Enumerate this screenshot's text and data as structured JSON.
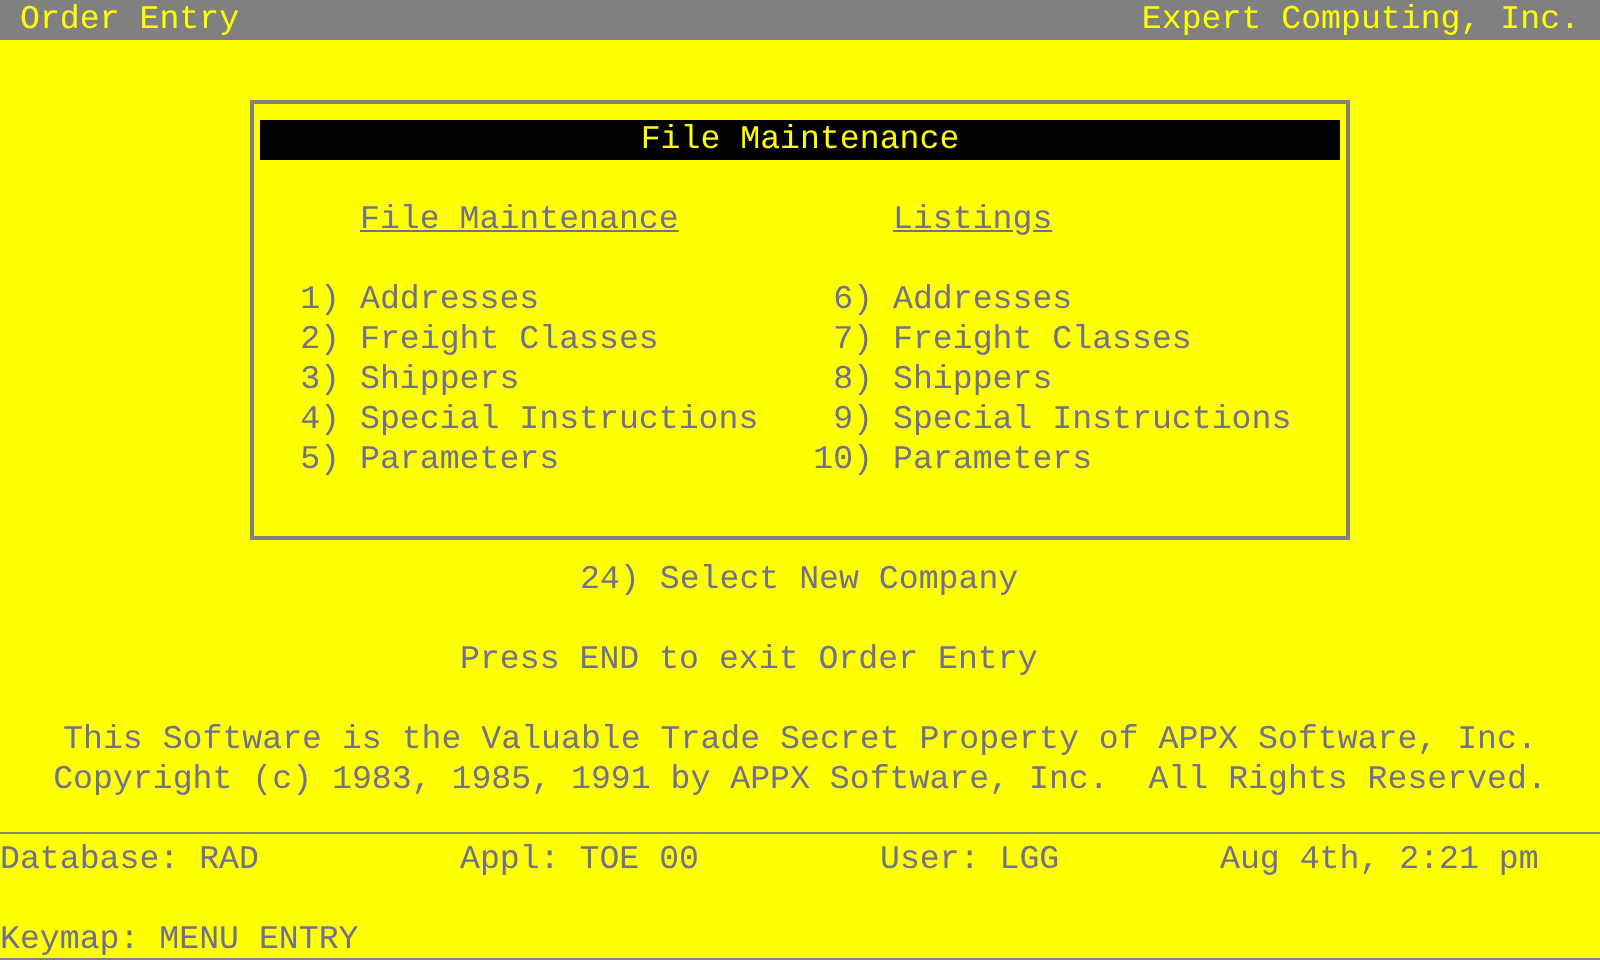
{
  "title_bar": {
    "left": "Order Entry",
    "right": "Expert Computing, Inc."
  },
  "menu_box": {
    "title": "File Maintenance",
    "columns": [
      {
        "heading": "File Maintenance",
        "items": [
          {
            "number": "1)",
            "label": "Addresses"
          },
          {
            "number": "2)",
            "label": "Freight Classes"
          },
          {
            "number": "3)",
            "label": "Shippers"
          },
          {
            "number": "4)",
            "label": "Special Instructions"
          },
          {
            "number": "5)",
            "label": "Parameters"
          }
        ]
      },
      {
        "heading": "Listings",
        "items": [
          {
            "number": "6)",
            "label": "Addresses"
          },
          {
            "number": "7)",
            "label": "Freight Classes"
          },
          {
            "number": "8)",
            "label": "Shippers"
          },
          {
            "number": "9)",
            "label": "Special Instructions"
          },
          {
            "number": "10)",
            "label": "Parameters"
          }
        ]
      }
    ]
  },
  "extra_option": {
    "number": "24)",
    "label": "Select New Company"
  },
  "exit_hint": "Press END to exit Order Entry",
  "notice": [
    "This Software is the Valuable Trade Secret Property of APPX Software, Inc.",
    "Copyright (c) 1983, 1985, 1991 by APPX Software, Inc.  All Rights Reserved."
  ],
  "status_bar": [
    "Database: RAD",
    "Appl: TOE 00",
    "User: LGG",
    "Aug 4th, 2:21 pm"
  ],
  "keymap": "Keymap: MENU ENTRY"
}
